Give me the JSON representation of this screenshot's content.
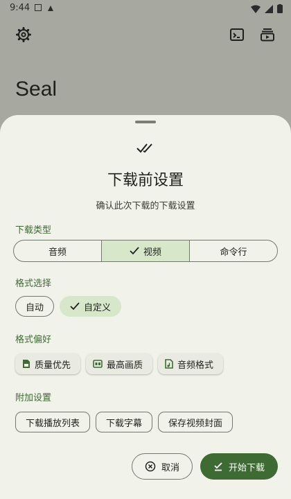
{
  "status_bar": {
    "time": "9:44"
  },
  "app": {
    "title": "Seal"
  },
  "sheet": {
    "title": "下载前设置",
    "subtitle": "确认此次下载的下载设置",
    "download_type": {
      "label": "下载类型",
      "options": [
        "音频",
        "视频",
        "命令行"
      ],
      "selected": "视频"
    },
    "format_select": {
      "label": "格式选择",
      "chips": [
        "自动",
        "自定义"
      ],
      "selected": "自定义"
    },
    "format_pref": {
      "label": "格式偏好",
      "chips": [
        {
          "icon": "file-icon",
          "label": "质量优先"
        },
        {
          "icon": "hq-icon",
          "label": "最高画质"
        },
        {
          "icon": "audio-file-icon",
          "label": "音频格式"
        }
      ]
    },
    "extra": {
      "label": "附加设置",
      "chips": [
        "下载播放列表",
        "下载字幕",
        "保存视频封面"
      ]
    },
    "buttons": {
      "cancel": "取消",
      "start": "开始下载"
    }
  },
  "colors": {
    "accent": "#3e6a34",
    "selected_bg": "#d6e8c9",
    "sheet_bg": "#f1f2ea",
    "scrim": "#a7a8a0"
  }
}
